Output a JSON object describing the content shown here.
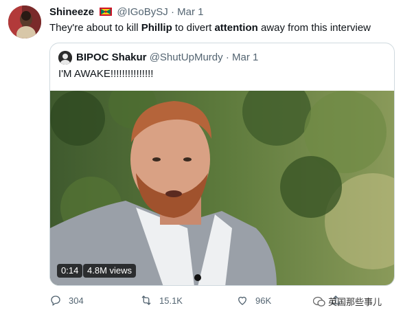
{
  "tweet": {
    "author_name": "Shineeze",
    "handle": "@IGoBySJ",
    "separator": "·",
    "date": "Mar 1",
    "text_parts": [
      "They're about to kill ",
      "Phillip",
      " to divert ",
      "attention",
      " away from this interview"
    ]
  },
  "quoted": {
    "author_name": "BIPOC Shakur",
    "handle": "@ShutUpMurdy",
    "separator": "·",
    "date": "Mar 1",
    "text": "I'M AWAKE!!!!!!!!!!!!!!!",
    "video": {
      "duration": "0:14",
      "views": "4.8M views"
    }
  },
  "actions": {
    "reply_count": "304",
    "retweet_count": "15.1K",
    "like_count": "96K"
  },
  "watermark": {
    "text": "英国那些事儿"
  },
  "colors": {
    "muted": "#536471",
    "border": "#cfd9de",
    "text": "#0f1419"
  }
}
